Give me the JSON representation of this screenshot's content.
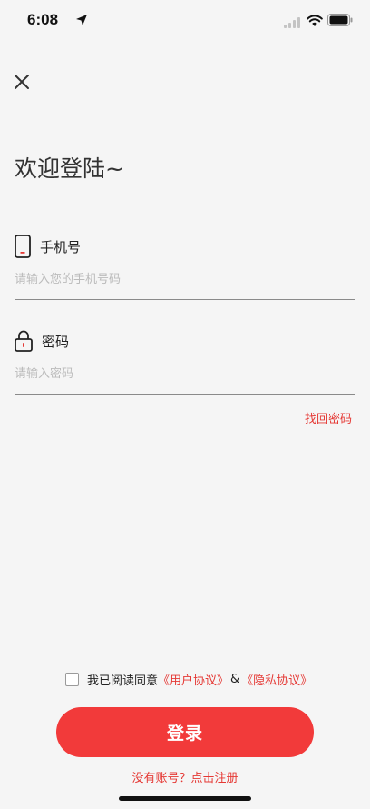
{
  "status_bar": {
    "time": "6:08",
    "icons": [
      "location-arrow-icon",
      "signal-icon",
      "wifi-icon",
      "battery-icon"
    ]
  },
  "header": {
    "close_icon": "close-icon"
  },
  "page": {
    "title": "欢迎登陆~"
  },
  "phone_field": {
    "icon": "phone-icon",
    "label": "手机号",
    "placeholder": "请输入您的手机号码",
    "value": ""
  },
  "password_field": {
    "icon": "lock-icon",
    "label": "密码",
    "placeholder": "请输入密码",
    "value": ""
  },
  "forgot_password": "找回密码",
  "agreement": {
    "checked": false,
    "prefix": "我已阅读同意",
    "user_agreement": "《用户协议》",
    "amp": "&",
    "privacy_policy": "《隐私协议》"
  },
  "login_button": "登录",
  "register_link": "没有账号？点击注册",
  "colors": {
    "accent": "#f23a3a",
    "link": "#e53935",
    "background": "#f5f5f5"
  }
}
